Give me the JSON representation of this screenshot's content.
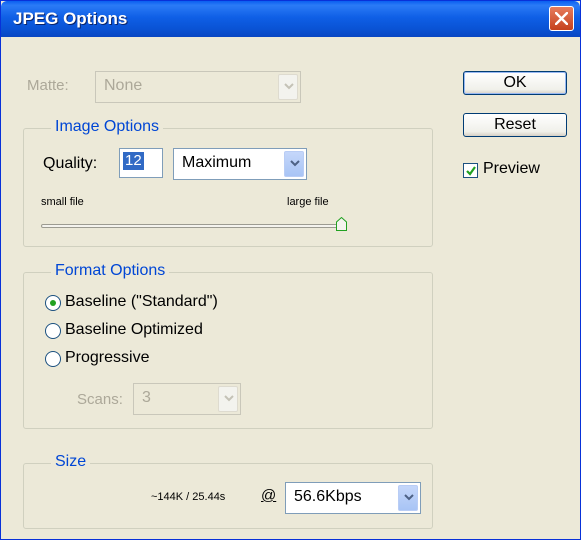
{
  "window": {
    "title": "JPEG Options"
  },
  "matte": {
    "label": "Matte:",
    "value": "None"
  },
  "image_options": {
    "title": "Image Options",
    "quality_label": "Quality:",
    "quality_value": "12",
    "quality_preset": "Maximum",
    "small_file": "small file",
    "large_file": "large file",
    "slider_fraction": 1.0
  },
  "format_options": {
    "title": "Format Options",
    "baseline_standard": "Baseline (\"Standard\")",
    "baseline_optimized": "Baseline Optimized",
    "progressive": "Progressive",
    "selected": "baseline_standard",
    "scans_label": "Scans:",
    "scans_value": "3"
  },
  "size": {
    "title": "Size",
    "estimate": "~144K / 25.44s",
    "at": "@",
    "speed": "56.6Kbps"
  },
  "buttons": {
    "ok": "OK",
    "reset": "Reset"
  },
  "preview": {
    "label": "Preview",
    "checked": true
  },
  "colors": {
    "title_bar": "#0a54d6",
    "group_title": "#0046d5",
    "dialog_bg": "#ece9d8"
  }
}
